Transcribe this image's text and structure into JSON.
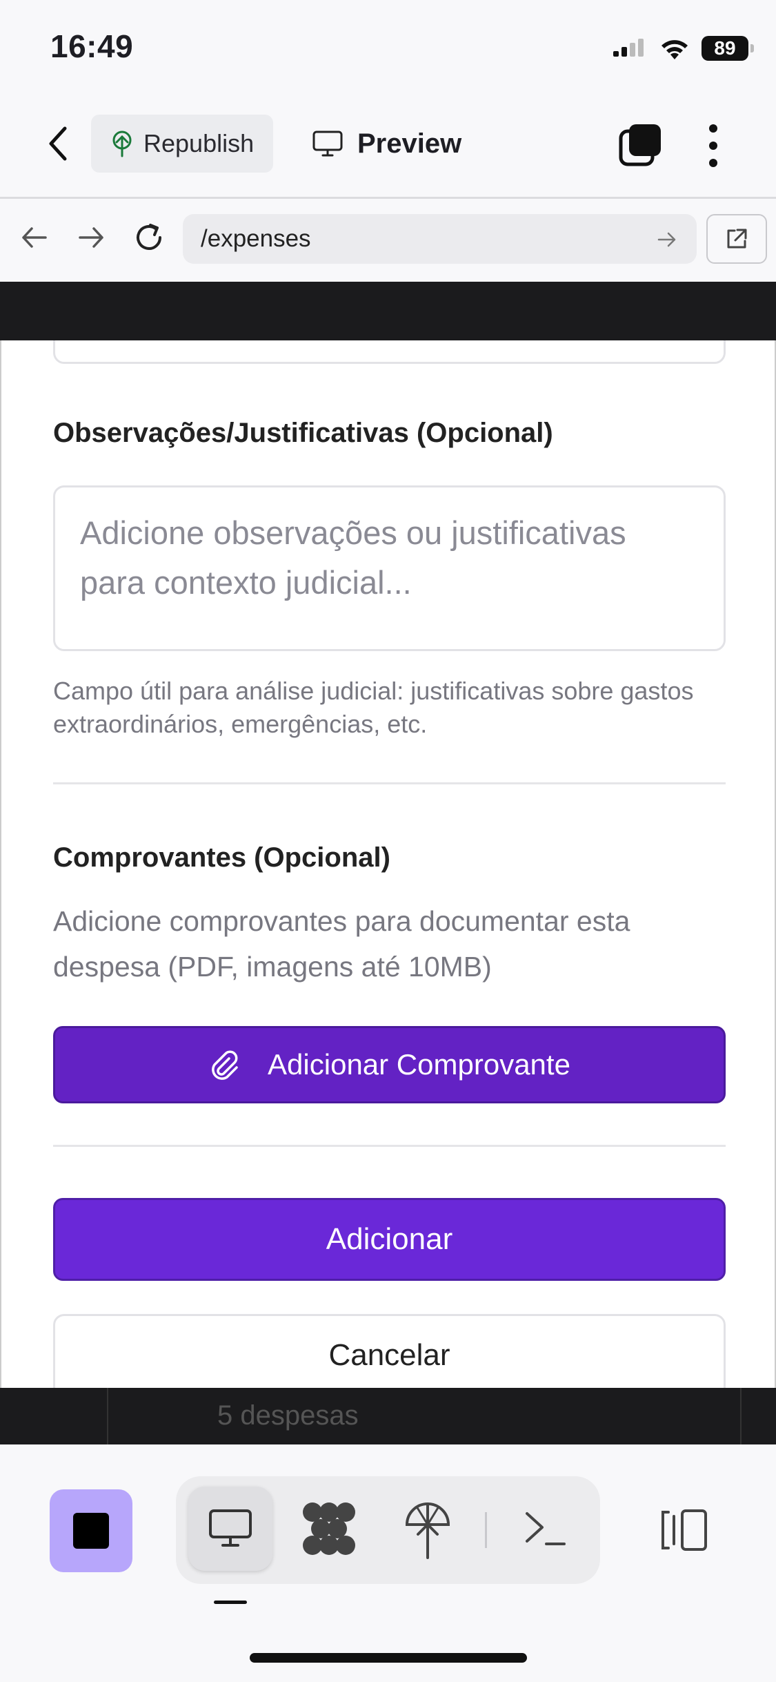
{
  "status_bar": {
    "time": "16:49",
    "battery": "89"
  },
  "toolbar": {
    "republish_label": "Republish",
    "preview_label": "Preview"
  },
  "browser": {
    "url": "/expenses"
  },
  "background": {
    "behind_text": "5 despesas"
  },
  "form": {
    "observations_label": "Observações/Justificativas (Opcional)",
    "observations_value": "",
    "observations_placeholder": "Adicione observações ou justificativas para contexto judicial...",
    "observations_help": "Campo útil para análise judicial: justificativas sobre gastos extraordinários, emergências, etc.",
    "receipts_label": "Comprovantes (Opcional)",
    "receipts_description": "Adicione comprovantes para documentar esta despesa (PDF, imagens até 10MB)",
    "attach_button": "Adicionar Comprovante",
    "submit_button": "Adicionar",
    "cancel_button": "Cancelar"
  },
  "dock": {
    "items": [
      "stop-icon",
      "desktop-icon",
      "apps-icon",
      "deploy-icon",
      "shell-icon",
      "split-view-icon"
    ],
    "accent": "#b7a6fb"
  },
  "colors": {
    "primary": "#6a28d8",
    "primary_dark": "#6322c4"
  }
}
